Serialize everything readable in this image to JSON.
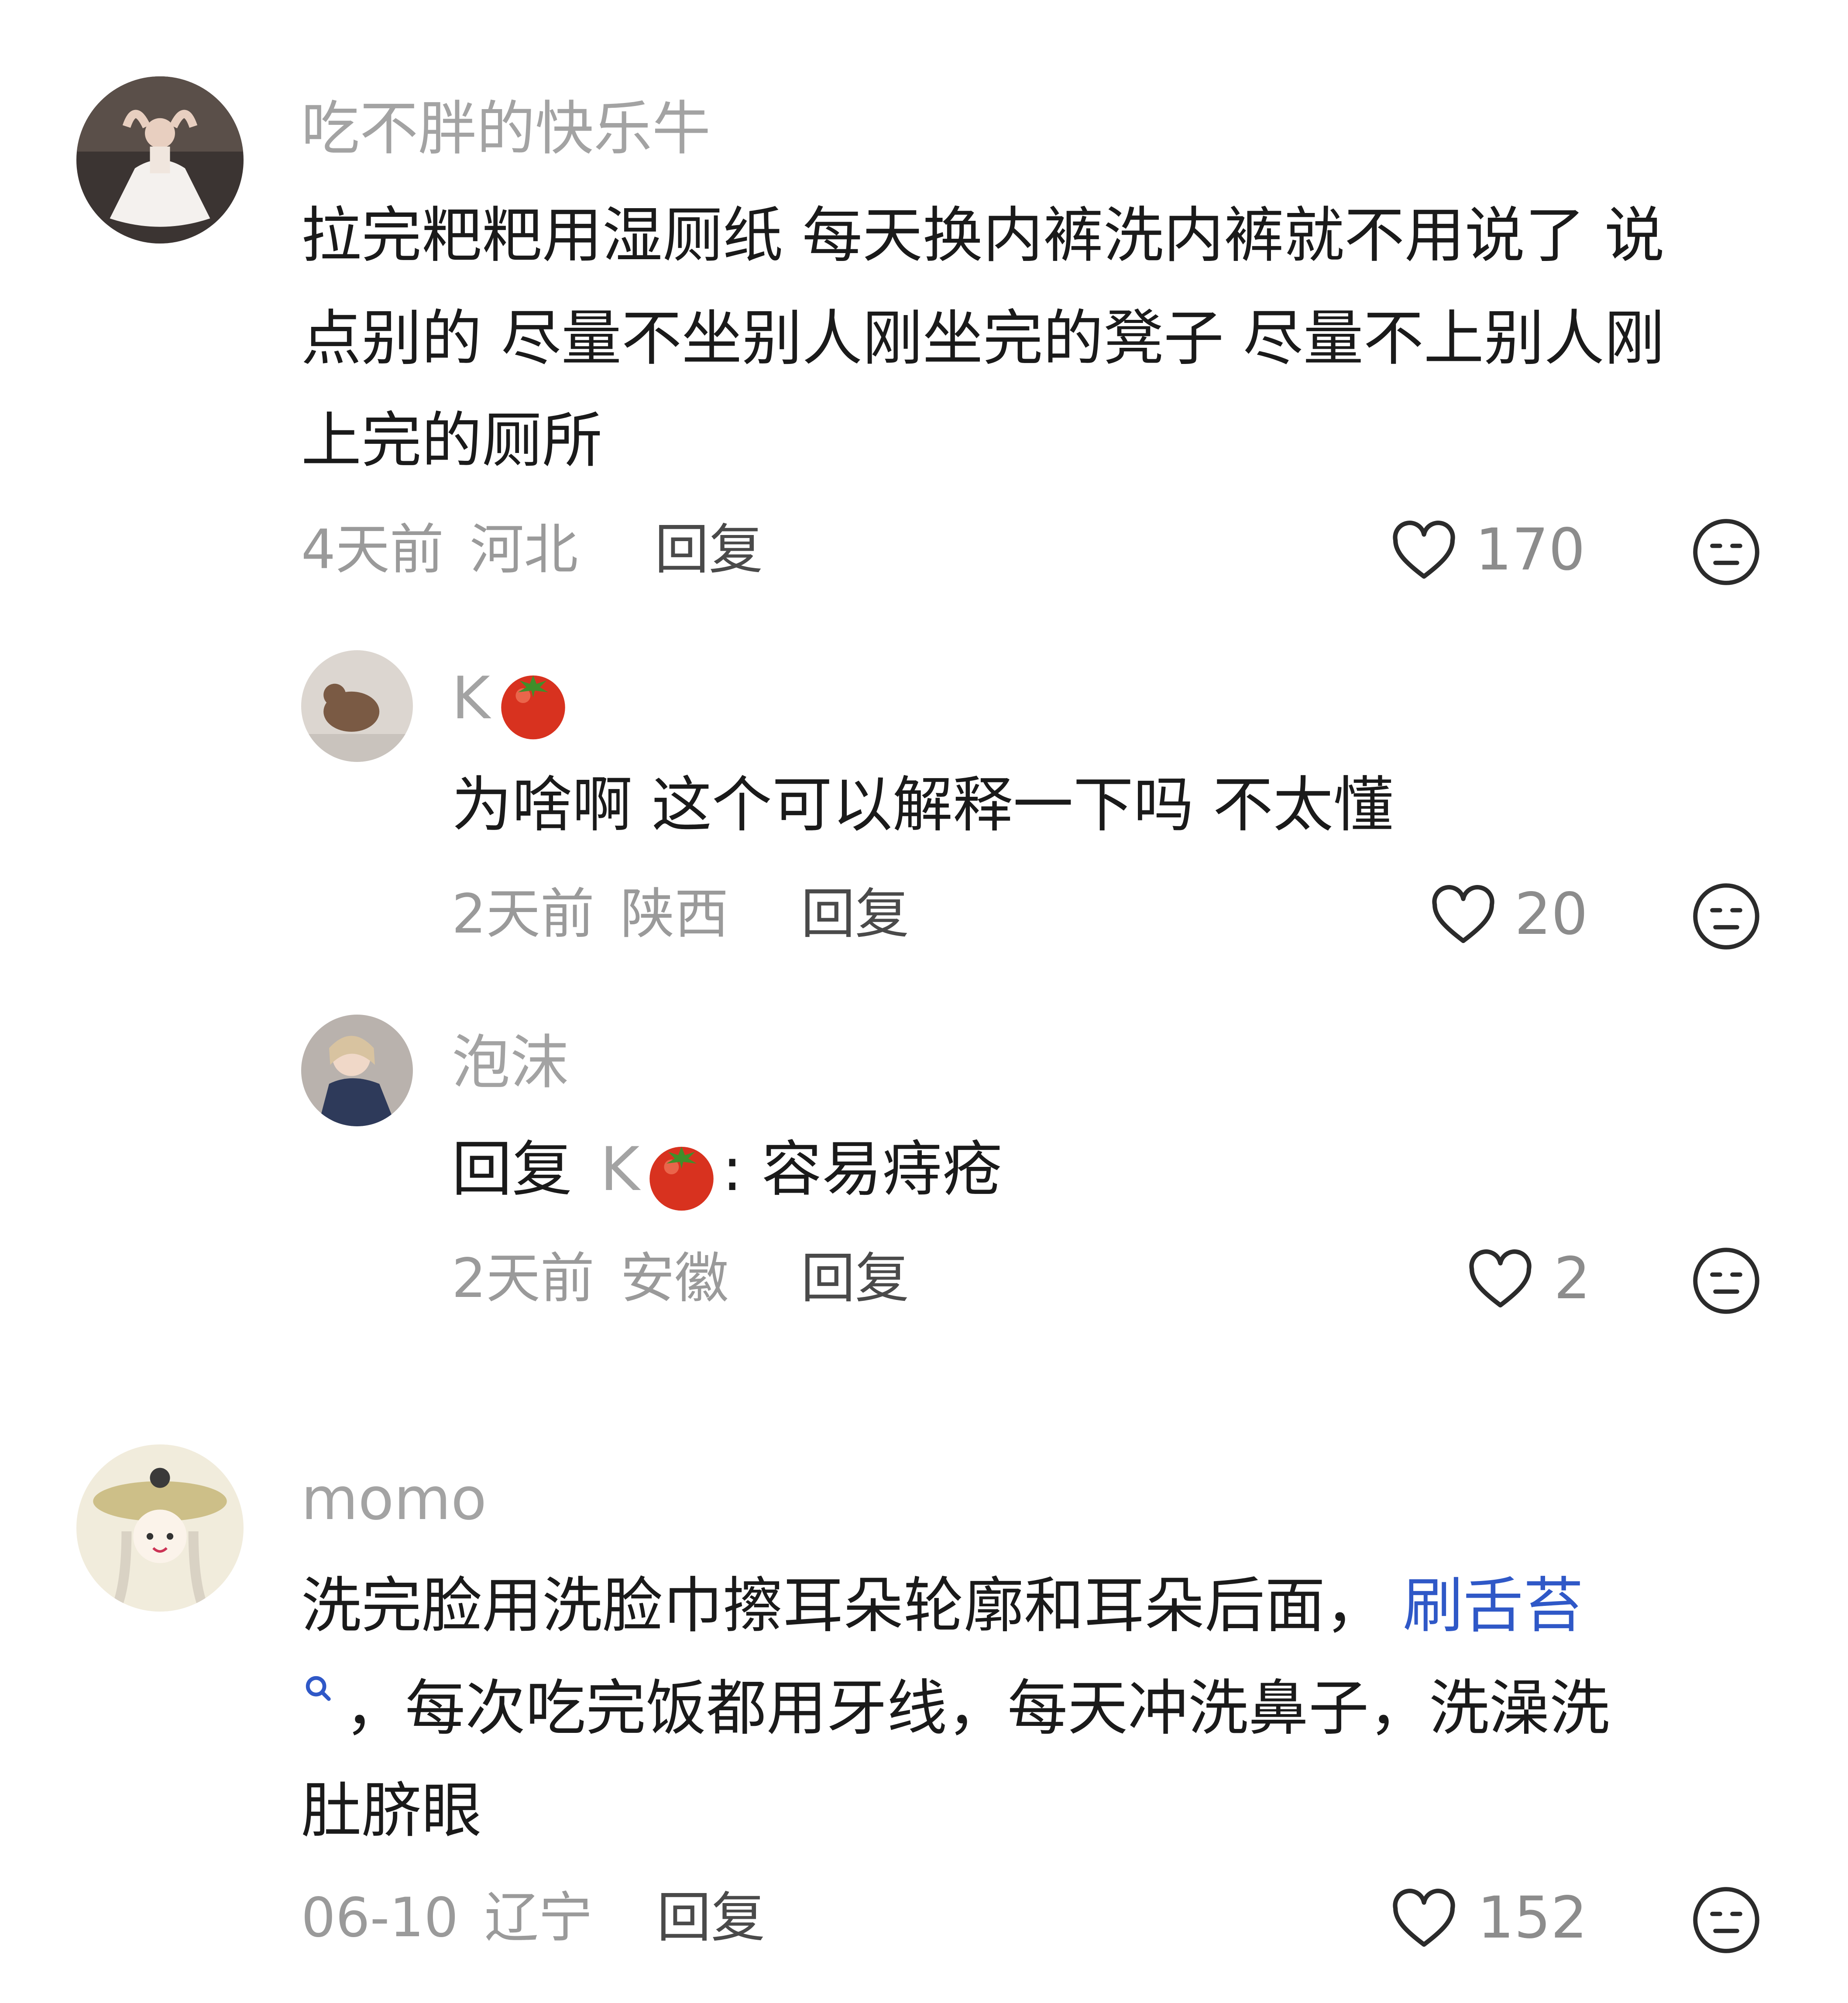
{
  "comments": [
    {
      "user": "吃不胖的快乐牛",
      "lines": [
        "拉完粑粑用湿厕纸 每天换内裤洗内裤就不用说了 说",
        "点别的 尽量不坐别人刚坐完的凳子 尽量不上别人刚",
        "上完的厕所"
      ],
      "time": "4天前",
      "location": "河北",
      "reply_label": "回复",
      "likes": "170"
    },
    {
      "user": "K",
      "lines": [
        "为啥啊 这个可以解释一下吗 不太懂"
      ],
      "time": "2天前",
      "location": "陕西",
      "reply_label": "回复",
      "likes": "20"
    },
    {
      "user": "泡沫",
      "reply_prefix": "回复",
      "reply_target": "K",
      "reply_text": ": 容易痔疮",
      "time": "2天前",
      "location": "安徽",
      "reply_label": "回复",
      "likes": "2"
    },
    {
      "user": "momo",
      "line1": "洗完脸用洗脸巾擦耳朵轮廓和耳朵后面，",
      "link": "刷舌苔",
      "line2": "，每次吃完饭都用牙线，每天冲洗鼻子，洗澡洗",
      "line3": "肚脐眼",
      "time": "06-10",
      "location": "辽宁",
      "reply_label": "回复",
      "likes": "152"
    }
  ],
  "icons": {
    "like": "heart-outline-icon",
    "dislike": "meh-face-icon",
    "search": "search-icon",
    "emoji": "tomato-emoji"
  },
  "colors": {
    "link": "#2f58c7",
    "username": "#a3a3a3",
    "meta": "#9a9a9a"
  }
}
